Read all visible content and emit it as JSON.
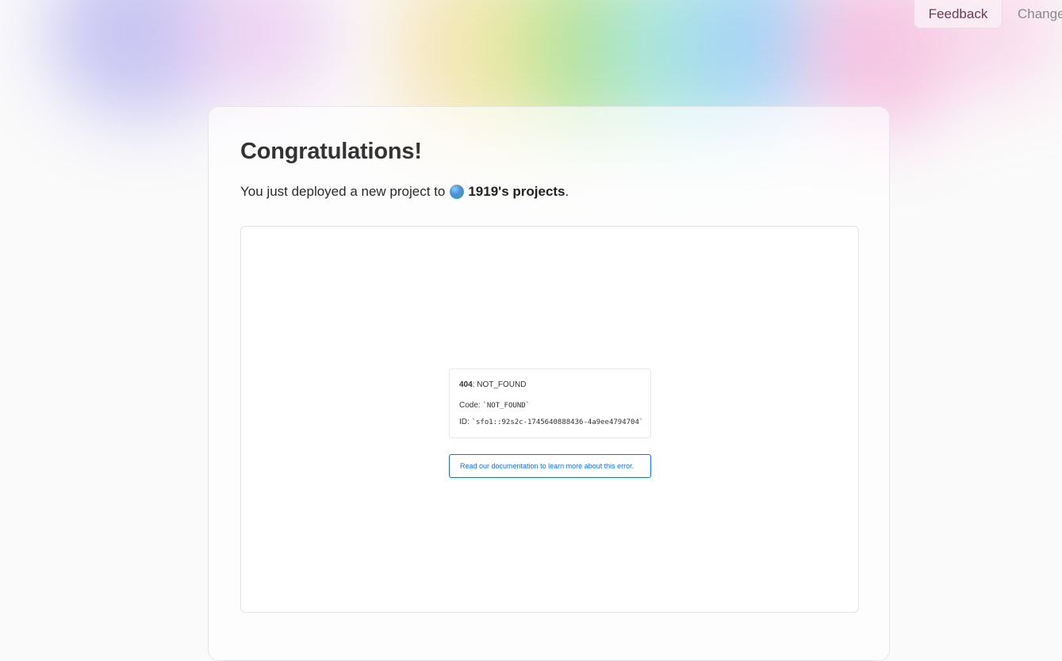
{
  "nav": {
    "feedback_label": "Feedback",
    "changelog_label": "Changelog"
  },
  "hero": {
    "title": "Congratulations!",
    "subtitle_prefix": "You just deployed a new project to",
    "team_name": "1919's projects",
    "subtitle_suffix": "."
  },
  "preview": {
    "error_status": "404",
    "error_separator": ": ",
    "error_name": "NOT_FOUND",
    "code_label": "Code: ",
    "code_value": "`NOT_FOUND`",
    "id_label": "ID: ",
    "id_value": "`sfo1::92s2c-1745640888436-4a9ee4794704`",
    "docs_link_label": "Read our documentation to learn more about this error."
  }
}
